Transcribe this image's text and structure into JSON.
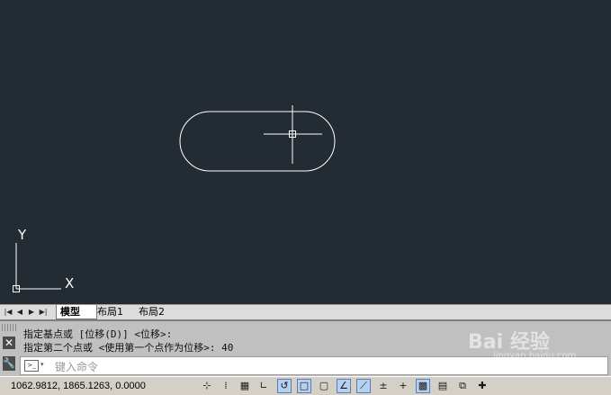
{
  "layout_tabs": {
    "model": "模型",
    "layout1": "布局1",
    "layout2": "布局2"
  },
  "nav": [
    "|◀",
    "◀",
    "▶",
    "▶|"
  ],
  "ucs": {
    "x_label": "X",
    "y_label": "Y"
  },
  "command": {
    "history": [
      "指定基点或 [位移(D)] <位移>:",
      "指定第二个点或 <使用第一个点作为位移>: 40"
    ],
    "input_placeholder": "键入命令"
  },
  "status": {
    "coordinates": "1062.9812, 1865.1263, 0.0000"
  },
  "status_icons": [
    "infer-constraints-icon",
    "snap-icon",
    "grid-icon",
    "ortho-icon",
    "polar-icon",
    "osnap-icon",
    "3dosnap-icon",
    "otrack-icon",
    "ducs-icon",
    "dyn-icon",
    "lineweight-icon",
    "transparency-icon",
    "quick-properties-icon",
    "selection-cycling-icon",
    "annotation-monitor-icon"
  ],
  "watermark": {
    "title": "Bai 经验",
    "sub": "jingyan.baidu.com"
  },
  "colors": {
    "canvas": "#232b33",
    "geometry": "#ffffff",
    "panel": "#c0c0c0"
  }
}
